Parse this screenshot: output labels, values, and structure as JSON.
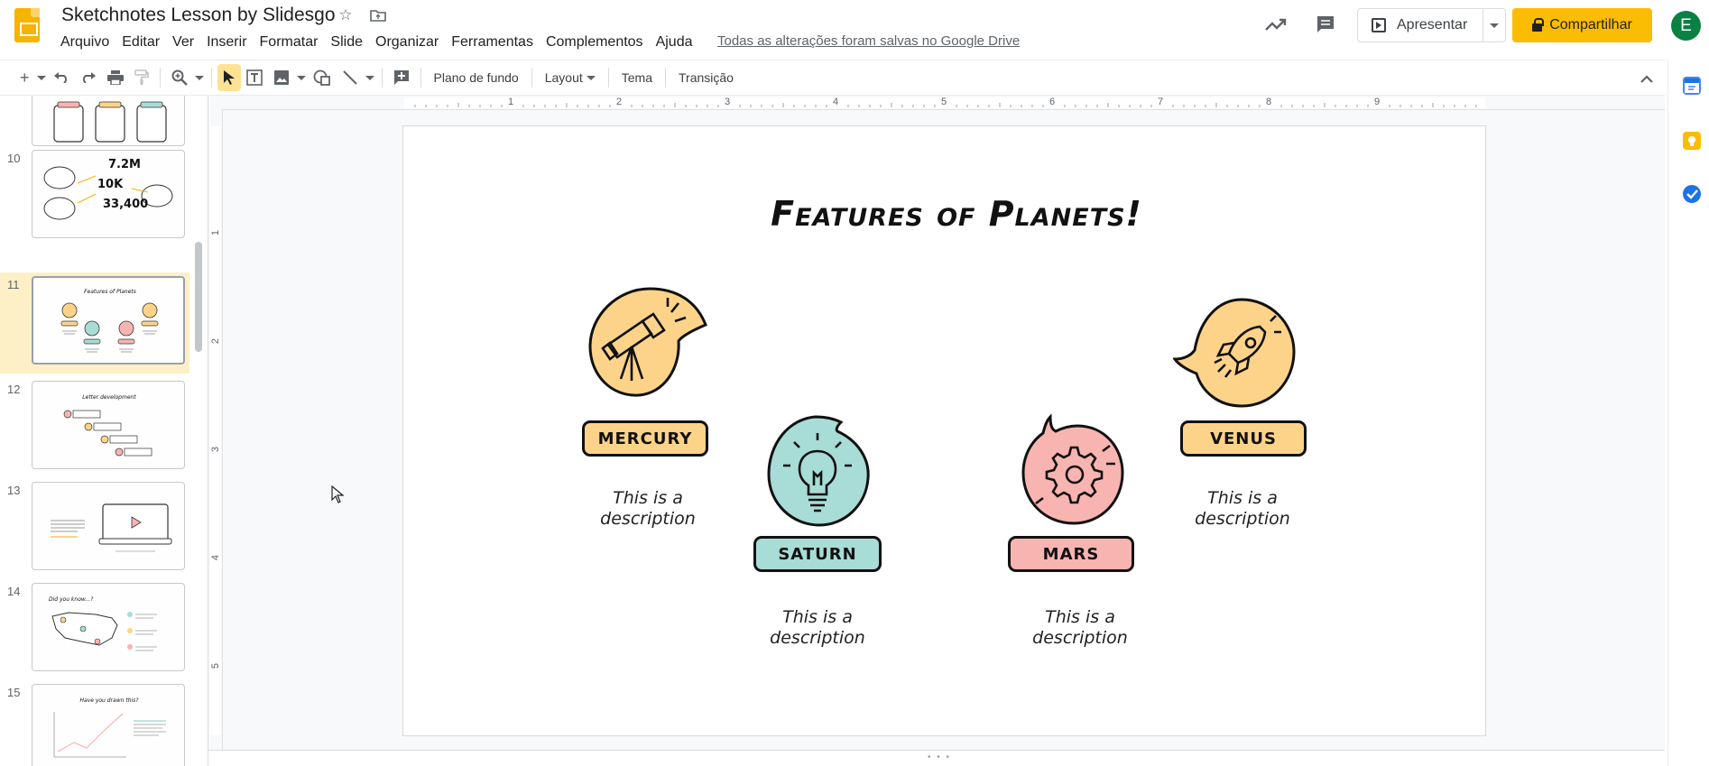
{
  "app": {
    "doc_title": "Sketchnotes Lesson by Slidesgo",
    "save_status": "Todas as alterações foram salvas no Google Drive"
  },
  "menu": [
    "Arquivo",
    "Editar",
    "Ver",
    "Inserir",
    "Formatar",
    "Slide",
    "Organizar",
    "Ferramentas",
    "Complementos",
    "Ajuda"
  ],
  "header": {
    "present_label": "Apresentar",
    "share_label": "Compartilhar",
    "avatar_letter": "E"
  },
  "toolbar": {
    "background_label": "Plano de fundo",
    "layout_label": "Layout",
    "theme_label": "Tema",
    "transition_label": "Transição"
  },
  "ruler": {
    "horizontal": [
      "1",
      "2",
      "3",
      "4",
      "5",
      "6",
      "7",
      "8",
      "9"
    ],
    "vertical": [
      "1",
      "2",
      "3",
      "4",
      "5"
    ]
  },
  "filmstrip": {
    "slides": [
      {
        "number": "10",
        "texts": [
          "7.2M",
          "10K",
          "33,400"
        ]
      },
      {
        "number": "11",
        "selected": true,
        "title": "Features of Planets"
      },
      {
        "number": "12",
        "title": "Letter development"
      },
      {
        "number": "13"
      },
      {
        "number": "14",
        "title": "Did you know...?"
      },
      {
        "number": "15",
        "title": "Have you drawn this?"
      }
    ]
  },
  "slide": {
    "title": "Features of Planets!",
    "planets": [
      {
        "name": "MERCURY",
        "description": "This is a description",
        "color": "#fdd38a"
      },
      {
        "name": "SATURN",
        "description": "This is a description",
        "color": "#a8dcd6"
      },
      {
        "name": "MARS",
        "description": "This is a description",
        "color": "#f8b4b0"
      },
      {
        "name": "VENUS",
        "description": "This is a description",
        "color": "#fdd38a"
      }
    ]
  },
  "colors": {
    "accent": "#fbbc04",
    "selection": "#fdf0c6",
    "avatar": "#0b8043"
  }
}
